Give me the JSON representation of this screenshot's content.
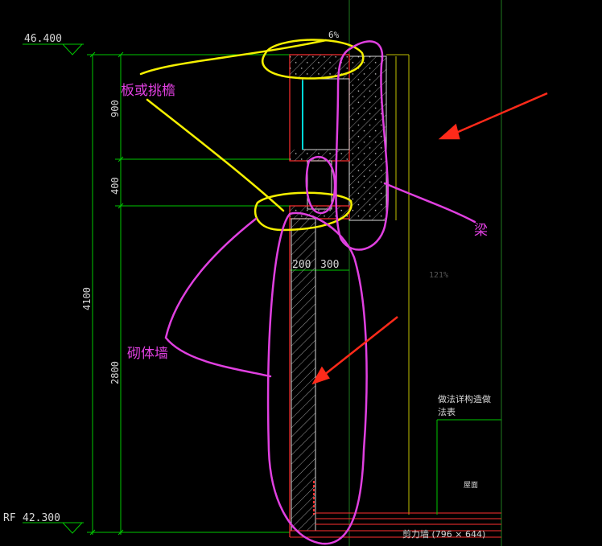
{
  "elevations": {
    "top": "46.400",
    "bottom_prefix": "RF",
    "bottom": "42.300"
  },
  "dimensions": {
    "d900": "900",
    "d400": "400",
    "d4100": "4100",
    "d2800": "2800",
    "w200": "200",
    "w300": "300"
  },
  "slope_label": "6%",
  "zoom_label": "121%",
  "annotations": {
    "slab_or_eave": "板或挑檐",
    "beam": "梁",
    "masonry_wall": "砌体墙"
  },
  "notes": {
    "method_line1": "做法详构造做",
    "method_line2": "法表",
    "roof": "屋面"
  },
  "status": {
    "caption": "剪力墙 (796 × 644)"
  },
  "colors": {
    "background": "#000000",
    "cad_line": "#00c800",
    "cad_text": "#d8d8d8",
    "wall_line": "#ff3030",
    "yellow_mark": "#f5f000",
    "magenta_mark": "#e040e0",
    "arrow_red": "#ff2a1a",
    "cyan_line": "#00d8d8"
  }
}
